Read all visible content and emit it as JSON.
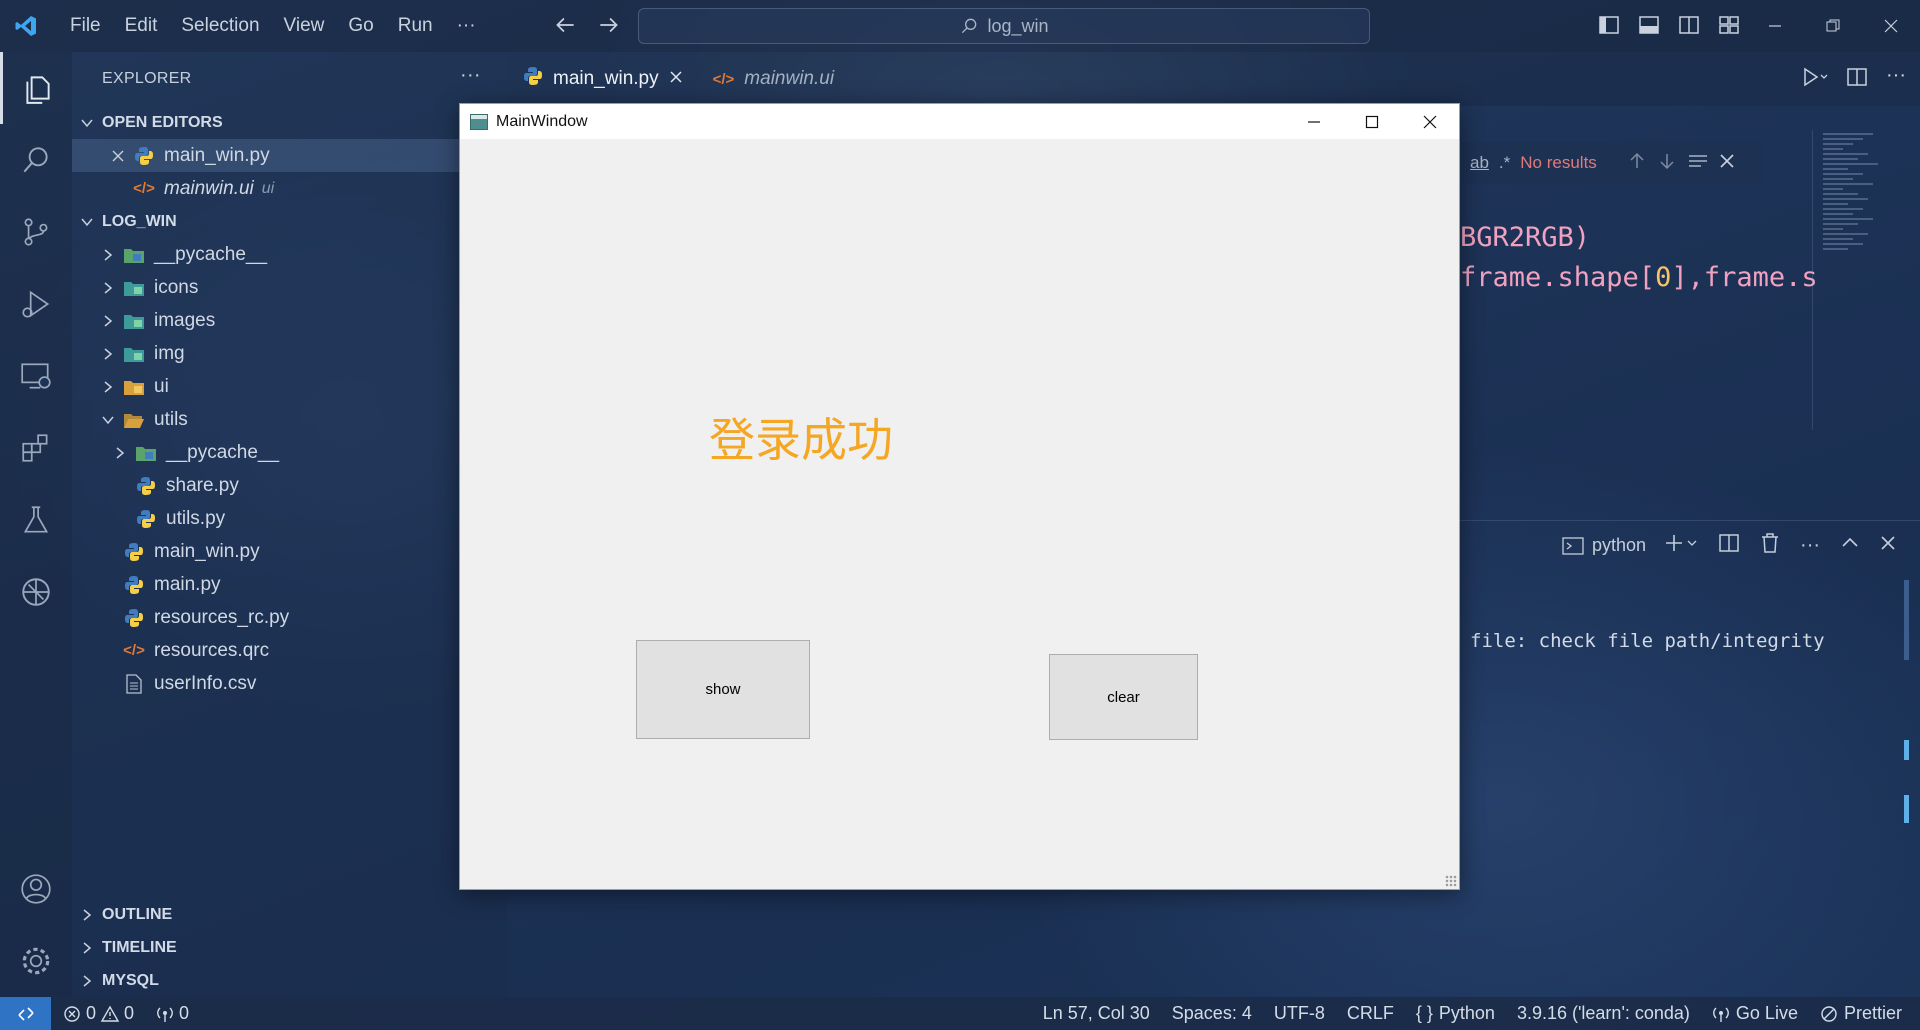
{
  "titlebar": {
    "menu": [
      "File",
      "Edit",
      "Selection",
      "View",
      "Go",
      "Run",
      "···"
    ],
    "search_text": "log_win"
  },
  "explorer": {
    "title": "EXPLORER",
    "more": "···",
    "open_editors_header": "OPEN EDITORS",
    "open_editors": [
      {
        "name": "main_win.py"
      },
      {
        "name": "mainwin.ui",
        "hint": "ui"
      }
    ],
    "project_header": "LOG_WIN",
    "tree": [
      {
        "name": "__pycache__"
      },
      {
        "name": "icons"
      },
      {
        "name": "images"
      },
      {
        "name": "img"
      },
      {
        "name": "ui"
      },
      {
        "name": "utils"
      },
      {
        "name": "__pycache__"
      },
      {
        "name": "share.py"
      },
      {
        "name": "utils.py"
      },
      {
        "name": "main_win.py"
      },
      {
        "name": "main.py"
      },
      {
        "name": "resources_rc.py"
      },
      {
        "name": "resources.qrc"
      },
      {
        "name": "userInfo.csv"
      }
    ],
    "outline": "OUTLINE",
    "timeline": "TIMELINE",
    "mysql": "MYSQL"
  },
  "tabs": [
    {
      "label": "main_win.py",
      "active": true
    },
    {
      "label": "mainwin.ui",
      "active": false
    }
  ],
  "find": {
    "no_results": "No results"
  },
  "code": {
    "line1": "BGR2RGB)",
    "line2_a": "frame.shape[",
    "line2_num": "0",
    "line2_b": "],frame.s"
  },
  "panel": {
    "terminal_name": "python",
    "output": "file: check file path/integrity"
  },
  "statusbar": {
    "errors": "0",
    "warnings": "0",
    "ports": "0",
    "position": "Ln 57, Col 30",
    "spaces": "Spaces: 4",
    "encoding": "UTF-8",
    "eol": "CRLF",
    "language": "Python",
    "interpreter": "3.9.16 ('learn': conda)",
    "golive": "Go Live",
    "prettier": "Prettier"
  },
  "qt_window": {
    "title": "MainWindow",
    "label": "登录成功",
    "label_color": "#f5a623",
    "show_button": "show",
    "clear_button": "clear"
  },
  "colors": {
    "accent_blue": "#2e73c4",
    "code_pink": "#f0a2c0",
    "code_number": "#f5c36a",
    "no_results_red": "#e07a7a"
  }
}
